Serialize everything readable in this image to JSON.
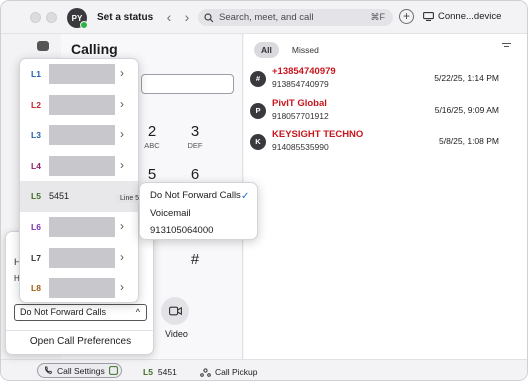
{
  "header": {
    "avatar_initials": "PY",
    "status_link": "Set a status",
    "search_placeholder": "Search, meet, and call",
    "search_shortcut": "⌘F",
    "device_label": "Conne...device"
  },
  "calling": {
    "title": "Calling",
    "keys": [
      {
        "digit": "2",
        "letters": "ABC"
      },
      {
        "digit": "3",
        "letters": "DEF"
      },
      {
        "digit": "5",
        "letters": ""
      },
      {
        "digit": "6",
        "letters": ""
      },
      {
        "digit": "#",
        "letters": ""
      }
    ],
    "video_label": "Video"
  },
  "history": {
    "tabs": [
      "All",
      "Missed"
    ],
    "calls": [
      {
        "initial": "#",
        "name": "+13854740979",
        "number": "913854740979",
        "date": "5/22/25, 1:14 PM"
      },
      {
        "initial": "P",
        "name": "PivIT Global",
        "number": "918057701912",
        "date": "5/16/25, 9:09 AM"
      },
      {
        "initial": "K",
        "name": "KEYSIGHT TECHNO",
        "number": "914085535990",
        "date": "5/8/25, 1:08 PM"
      }
    ]
  },
  "lines": [
    {
      "code": "L1",
      "color": "#1d5fa8",
      "label": ""
    },
    {
      "code": "L2",
      "color": "#c0262d",
      "label": ""
    },
    {
      "code": "L3",
      "color": "#1d5fa8",
      "label": ""
    },
    {
      "code": "L4",
      "color": "#8c1f6b",
      "label": ""
    },
    {
      "code": "L5",
      "color": "#3b6f1e",
      "label": "5451"
    },
    {
      "code": "L6",
      "color": "#7a2fb0",
      "label": ""
    },
    {
      "code": "L7",
      "color": "#333333",
      "label": ""
    },
    {
      "code": "L8",
      "color": "#a05a0c",
      "label": ""
    }
  ],
  "tooltip": "Line 5, 5451",
  "forwarding_menu": {
    "options": [
      "Do Not Forward Calls",
      "Voicemail",
      "913105064000"
    ],
    "selected_index": 0
  },
  "settings_popover": {
    "hints": [
      "H",
      "H",
      ""
    ],
    "forward_select_value": "Do Not Forward Calls",
    "open_preferences": "Open Call Preferences"
  },
  "bottombar": {
    "call_settings": "Call Settings",
    "line_code": "L5",
    "line_number": "5451",
    "call_pickup": "Call Pickup"
  }
}
